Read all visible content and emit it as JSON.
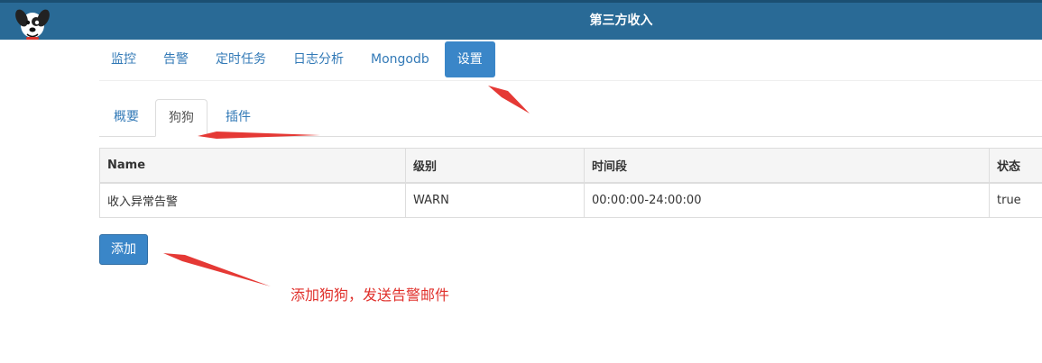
{
  "header": {
    "title": "第三方收入"
  },
  "main_nav": {
    "items": [
      {
        "label": "监控"
      },
      {
        "label": "告警"
      },
      {
        "label": "定时任务"
      },
      {
        "label": "日志分析"
      },
      {
        "label": "Mongodb"
      },
      {
        "label": "设置",
        "active": true
      }
    ]
  },
  "sub_tabs": {
    "items": [
      {
        "label": "概要"
      },
      {
        "label": "狗狗",
        "active": true
      },
      {
        "label": "插件"
      }
    ]
  },
  "table": {
    "columns": [
      "Name",
      "级别",
      "时间段",
      "状态"
    ],
    "rows": [
      [
        "收入异常告警",
        "WARN",
        "00:00:00-24:00:00",
        "true"
      ]
    ]
  },
  "add_button": {
    "label": "添加"
  },
  "annotation": {
    "text": "添加狗狗，发送告警邮件",
    "color": "#e0302b"
  },
  "colors": {
    "header_bg": "#296a96",
    "accent": "#3a86c8",
    "link": "#337ab7"
  }
}
